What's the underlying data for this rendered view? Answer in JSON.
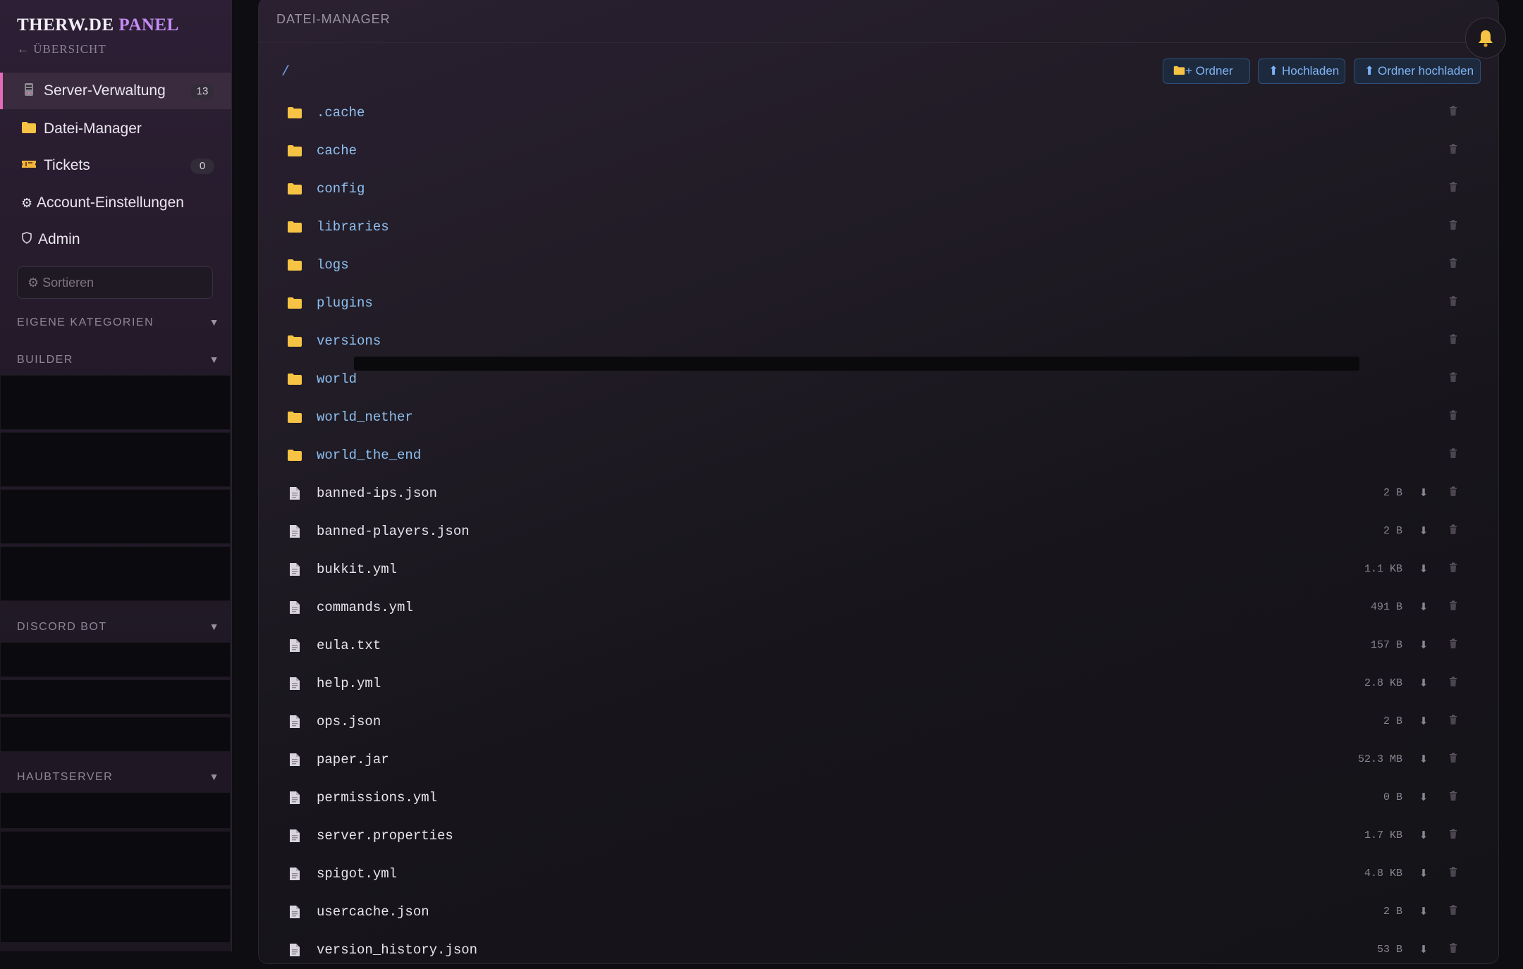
{
  "sidebar": {
    "brand_part1": "THERW.DE",
    "brand_part2": "PANEL",
    "back_label": "← ÜBERSICHT",
    "nav": [
      {
        "label": "Server-Verwaltung",
        "icon": "server-icon",
        "badge": "13",
        "active": true
      },
      {
        "label": "Datei-Manager",
        "icon": "folder-icon",
        "badge": null,
        "active": false
      },
      {
        "label": "Tickets",
        "icon": "ticket-icon",
        "badge": "0",
        "active": false
      },
      {
        "label": "Account-Einstellungen",
        "icon": "gear-icon",
        "badge": null,
        "active": false
      },
      {
        "label": "Admin",
        "icon": "shield-icon",
        "badge": null,
        "active": false
      }
    ],
    "sort_placeholder": "⚙ Sortieren",
    "sections": [
      {
        "label": "EIGENE KATEGORIEN",
        "arrow": "▼"
      },
      {
        "label": "BUILDER",
        "arrow": "▼"
      },
      {
        "label": "DISCORD BOT",
        "arrow": "▼"
      },
      {
        "label": "HAUBTSERVER",
        "arrow": "▼"
      }
    ]
  },
  "main": {
    "title": "DATEI-MANAGER",
    "path": "/",
    "buttons": {
      "new_folder": "+ Ordner",
      "upload": "⬆ Hochladen",
      "upload_folder": "⬆ Ordner hochladen"
    },
    "entries": [
      {
        "name": ".cache",
        "type": "dir",
        "size": ""
      },
      {
        "name": "cache",
        "type": "dir",
        "size": ""
      },
      {
        "name": "config",
        "type": "dir",
        "size": ""
      },
      {
        "name": "libraries",
        "type": "dir",
        "size": ""
      },
      {
        "name": "logs",
        "type": "dir",
        "size": ""
      },
      {
        "name": "plugins",
        "type": "dir",
        "size": ""
      },
      {
        "name": "versions",
        "type": "dir",
        "size": ""
      },
      {
        "name": "world",
        "type": "dir",
        "size": ""
      },
      {
        "name": "world_nether",
        "type": "dir",
        "size": ""
      },
      {
        "name": "world_the_end",
        "type": "dir",
        "size": ""
      },
      {
        "name": "banned-ips.json",
        "type": "file",
        "size": "2 B"
      },
      {
        "name": "banned-players.json",
        "type": "file",
        "size": "2 B"
      },
      {
        "name": "bukkit.yml",
        "type": "file",
        "size": "1.1 KB"
      },
      {
        "name": "commands.yml",
        "type": "file",
        "size": "491 B"
      },
      {
        "name": "eula.txt",
        "type": "file",
        "size": "157 B"
      },
      {
        "name": "help.yml",
        "type": "file",
        "size": "2.8 KB"
      },
      {
        "name": "ops.json",
        "type": "file",
        "size": "2 B"
      },
      {
        "name": "paper.jar",
        "type": "file",
        "size": "52.3 MB"
      },
      {
        "name": "permissions.yml",
        "type": "file",
        "size": "0 B"
      },
      {
        "name": "server.properties",
        "type": "file",
        "size": "1.7 KB"
      },
      {
        "name": "spigot.yml",
        "type": "file",
        "size": "4.8 KB"
      },
      {
        "name": "usercache.json",
        "type": "file",
        "size": "2 B"
      },
      {
        "name": "version_history.json",
        "type": "file",
        "size": "53 B"
      }
    ]
  },
  "colors": {
    "accent_pink": "#e46bb8",
    "brand_purple": "#c58cf5",
    "folder_yellow": "#f6c344",
    "link_blue": "#8ec0f0"
  }
}
